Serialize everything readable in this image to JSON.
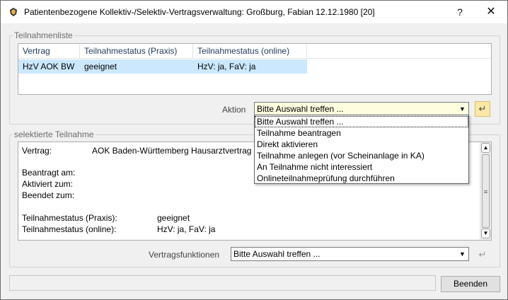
{
  "window": {
    "title": "Patientenbezogene Kollektiv-/Selektiv-Vertragsverwaltung: Großburg, Fabian 12.12.1980  [20]",
    "help_label": "?",
    "close_label": "✕"
  },
  "participation_list": {
    "legend": "Teilnahmenliste",
    "columns": [
      "Vertrag",
      "Teilnahmestatus (Praxis)",
      "Teilnahmestatus (online)"
    ],
    "rows": [
      {
        "vertrag": "HzV AOK BW",
        "status_praxis": "geeignet",
        "status_online": "HzV: ja, FaV: ja"
      }
    ]
  },
  "action": {
    "label": "Aktion",
    "selected": "Bitte Auswahl treffen ...",
    "options": [
      "Bitte Auswahl treffen ...",
      "Teilnahme beantragen",
      "Direkt aktivieren",
      "Teilnahme anlegen (vor Scheinanlage in KA)",
      "An Teilnahme nicht interessiert",
      "Onlineteilnahmeprüfung durchführen"
    ],
    "apply_icon": "↵"
  },
  "selected_participation": {
    "legend": "selektierte Teilnahme",
    "vertrag_label": "Vertrag:",
    "vertrag_value": "AOK Baden-Württemberg Hausarztvertrag",
    "beantragt_label": "Beantragt am:",
    "aktiviert_label": "Aktiviert zum:",
    "beendet_label": "Beendet zum:",
    "status_praxis_label": "Teilnahmestatus (Praxis):",
    "status_praxis_value": "geeignet",
    "status_online_label": "Teilnahmestatus (online):",
    "status_online_value": "HzV: ja, FaV: ja"
  },
  "contract_functions": {
    "label": "Vertragsfunktionen",
    "selected": "Bitte Auswahl treffen ...",
    "apply_icon": "↵"
  },
  "footer": {
    "status_text": "",
    "end_button": "Beenden"
  },
  "icons": {
    "app": "app-logo-icon",
    "dropdown": "chevron-down-icon",
    "scroll_up": "scroll-up-icon",
    "scroll_down": "scroll-down-icon"
  },
  "colors": {
    "selection": "#cce8ff",
    "active_combo": "#fffde0",
    "apply_enabled": "#fbe8a6"
  }
}
